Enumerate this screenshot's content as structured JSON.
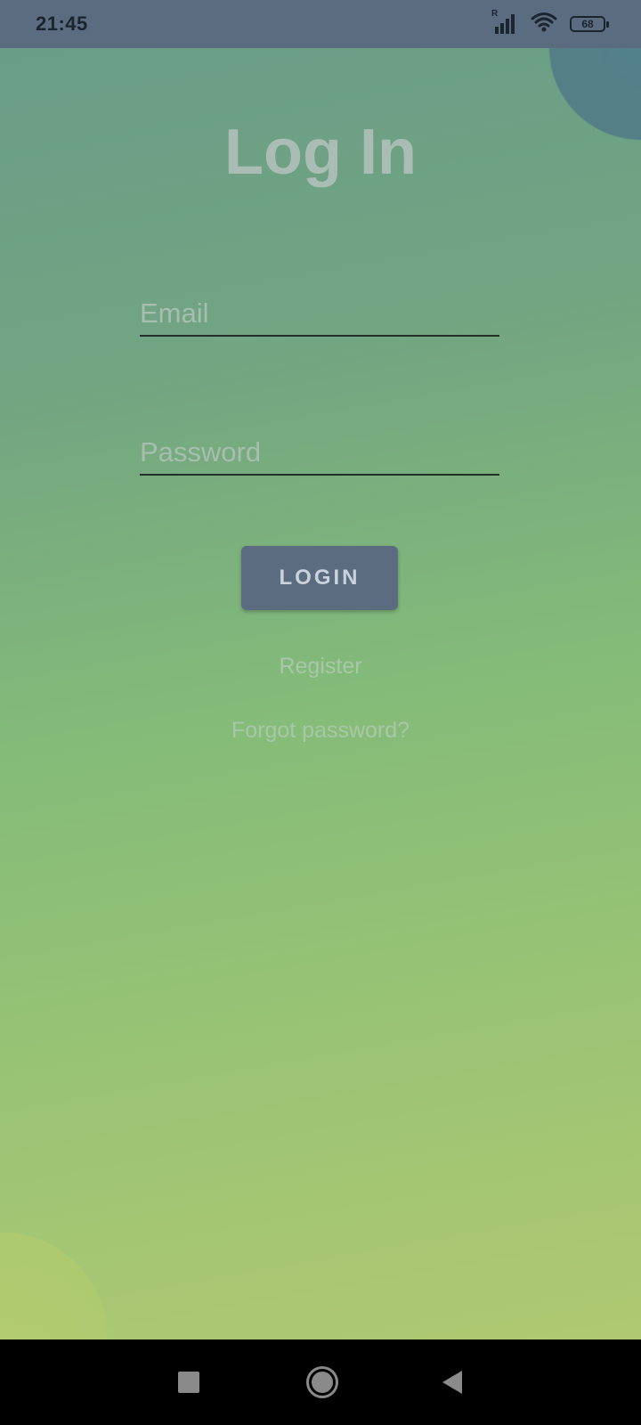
{
  "status_bar": {
    "time": "21:45",
    "roaming_label": "R",
    "battery_level": "68",
    "icons": [
      "signal-icon",
      "wifi-icon",
      "battery-icon"
    ]
  },
  "login": {
    "title": "Log In",
    "email_placeholder": "Email",
    "email_value": "",
    "password_placeholder": "Password",
    "password_value": "",
    "login_button_label": "LOGIN",
    "register_label": "Register",
    "forgot_label": "Forgot password?"
  },
  "nav_bar": {
    "icons": [
      "recent-apps-icon",
      "home-icon",
      "back-icon"
    ]
  },
  "colors": {
    "status_bar_bg": "#5b6b80",
    "button_bg": "#5b6b80",
    "gradient_top": "#6a9d88",
    "gradient_bottom": "#b0c872"
  }
}
